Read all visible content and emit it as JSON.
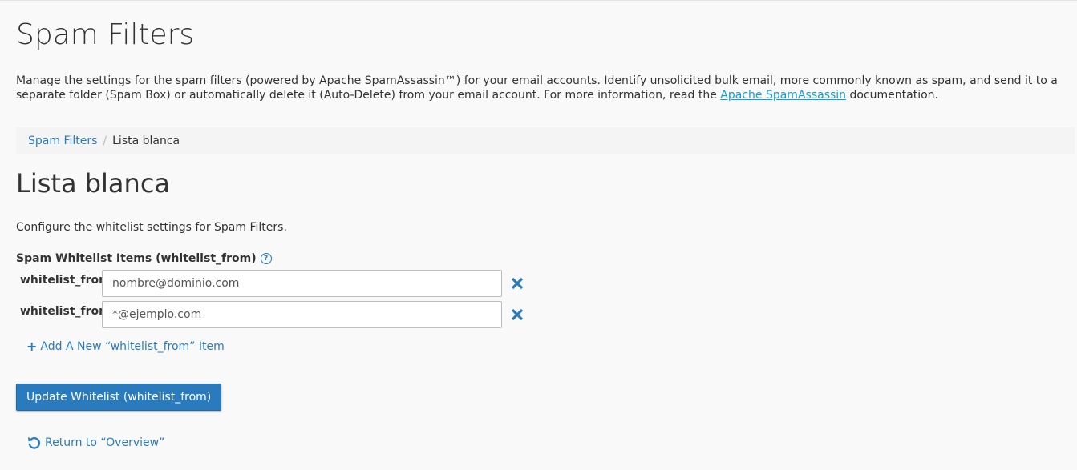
{
  "page": {
    "title": "Spam Filters",
    "description_prefix": "Manage the settings for the spam filters (powered by Apache SpamAssassin™) for your email accounts. Identify unsolicited bulk email, more commonly known as spam, and send it to a separate folder (Spam Box) or automatically delete it (Auto-Delete) from your email account. For more information, read the ",
    "description_link": "Apache SpamAssassin",
    "description_suffix": " documentation."
  },
  "breadcrumb": {
    "parent": "Spam Filters",
    "separator": "/",
    "current": "Lista blanca"
  },
  "section": {
    "title": "Lista blanca",
    "description": "Configure the whitelist settings for Spam Filters.",
    "items_label": "Spam Whitelist Items (whitelist_from)",
    "help_glyph": "?"
  },
  "whitelist_items": [
    {
      "label": "whitelist_from",
      "value": "nombre@dominio.com"
    },
    {
      "label": "whitelist_from",
      "value": "*@ejemplo.com"
    }
  ],
  "actions": {
    "add_plus": "+",
    "add_item": "Add A New “whitelist_from” Item",
    "update": "Update Whitelist (whitelist_from)",
    "return": "Return to “Overview”"
  },
  "colors": {
    "accent": "#2a7bbd",
    "link": "#179bd7",
    "text": "#333333",
    "background": "#f9f9f9"
  },
  "icons": {
    "help": "question-circle-icon",
    "remove": "close-x-icon",
    "add": "plus-icon",
    "return": "undo-arrow-icon"
  }
}
